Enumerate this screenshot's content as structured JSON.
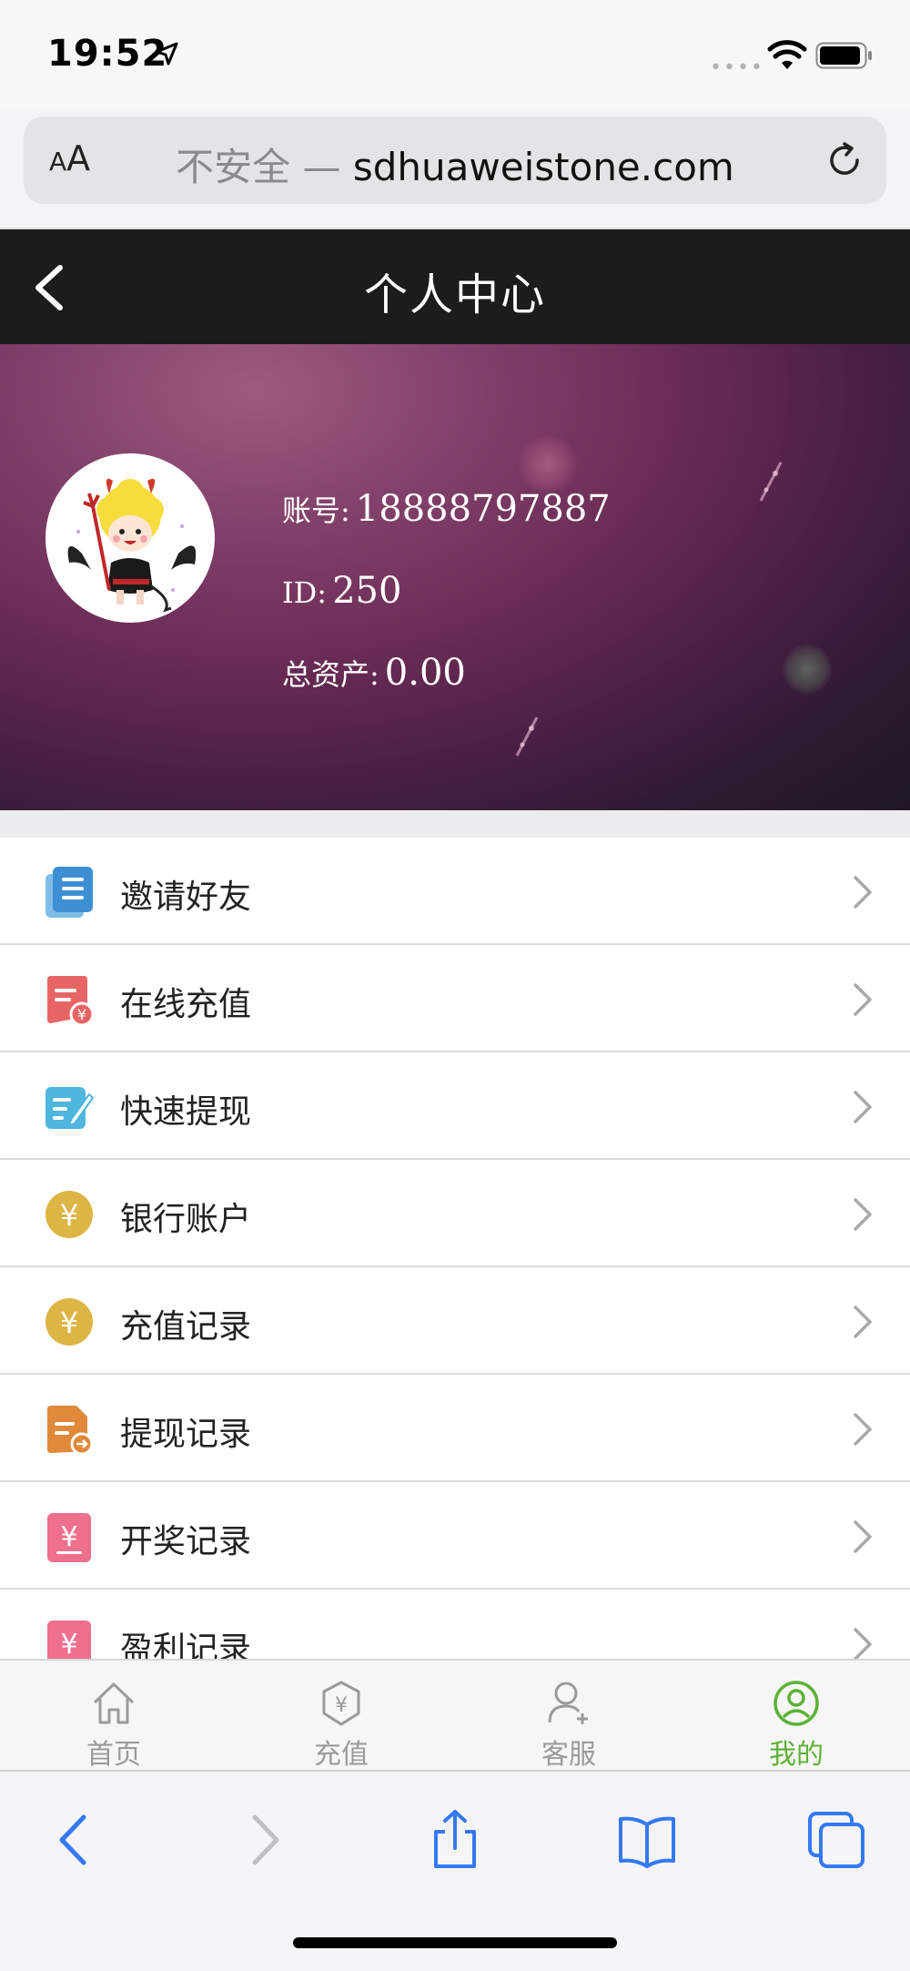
{
  "status_bar": {
    "time": "19:52",
    "signal_dots": "••••"
  },
  "browser": {
    "aa_small": "A",
    "aa_large": "A",
    "url_prefix": "不安全 —",
    "url_domain": "sdhuaweistone.com"
  },
  "header": {
    "title": "个人中心"
  },
  "profile": {
    "account_label": "账号:",
    "account_value": "18888797887",
    "id_label": "ID:",
    "id_value": "250",
    "assets_label": "总资产:",
    "assets_value": "0.00"
  },
  "menu": {
    "items": [
      {
        "label": "邀请好友",
        "icon": "invite-doc-icon",
        "color": "#4a9ad8"
      },
      {
        "label": "在线充值",
        "icon": "recharge-bill-icon",
        "color": "#e86a6a"
      },
      {
        "label": "快速提现",
        "icon": "withdraw-edit-icon",
        "color": "#4fb6de"
      },
      {
        "label": "银行账户",
        "icon": "yen-coin-icon",
        "color": "#ddb545"
      },
      {
        "label": "充值记录",
        "icon": "yen-coin-icon",
        "color": "#ddb545"
      },
      {
        "label": "提现记录",
        "icon": "withdraw-record-icon",
        "color": "#e0893a"
      },
      {
        "label": "开奖记录",
        "icon": "lottery-record-icon",
        "color": "#ee6f8e"
      },
      {
        "label": "盈利记录",
        "icon": "profit-record-icon",
        "color": "#ee6f8e"
      }
    ]
  },
  "tabbar": {
    "tabs": [
      {
        "label": "首页",
        "icon": "home-icon"
      },
      {
        "label": "充值",
        "icon": "recharge-shield-icon"
      },
      {
        "label": "客服",
        "icon": "add-user-icon"
      },
      {
        "label": "我的",
        "icon": "profile-icon",
        "active": true
      }
    ],
    "active_color": "#5db135",
    "inactive_color": "#9a9a9a"
  },
  "safari_toolbar": {
    "buttons": [
      "back-icon",
      "forward-icon",
      "share-icon",
      "bookmarks-icon",
      "tabs-icon"
    ],
    "accent": "#3478f6"
  }
}
